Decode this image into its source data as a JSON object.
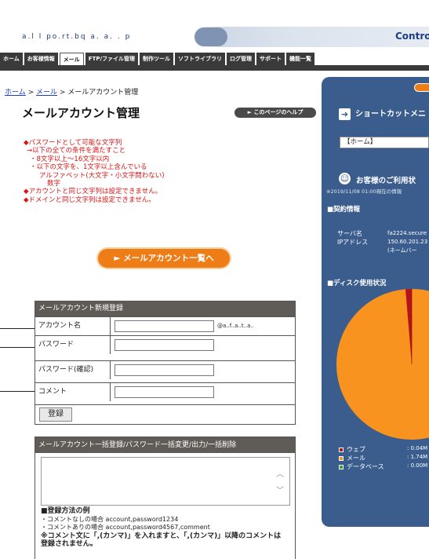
{
  "header": {
    "logo_text": "a.l l po.rt.bq a. a. . p",
    "control_label": "Contro"
  },
  "nav": {
    "items": [
      "ホーム",
      "お客様情報",
      "メール",
      "FTP/ファイル管理",
      "制作ツール",
      "ソフトライブラリ",
      "ログ管理",
      "サポート",
      "機能一覧"
    ],
    "active_index": 2
  },
  "breadcrumb": {
    "home": "ホーム",
    "sep1": " > ",
    "mail": "メール",
    "sep2": " > ",
    "current": "メールアカウント管理"
  },
  "page_title": "メールアカウント管理",
  "help_button": "► このページのヘルプ",
  "rules": [
    "◆パスワードとして可能な文字列",
    "→以下の全ての条件を満たすこと",
    "・8文字以上〜16文字以内",
    "・以下の文字を、1文字以上含んでいる",
    "アルファベット(大文字・小文字問わない)",
    "数字",
    "◆アカウントと同じ文字列は設定できません。",
    "◆ドメインと同じ文字列は設定できません。"
  ],
  "list_button": "► メールアカウント一覧へ",
  "form": {
    "title": "メールアカウント新規登録",
    "account_label": "アカウント名",
    "domain_suffix": "@a..f..a..t..a..",
    "password_label": "パスワード",
    "password_confirm_label": "パスワード(確認)",
    "comment_label": "コメント",
    "submit_label": "登録"
  },
  "bulk": {
    "title": "メールアカウント一括登録/パスワード一括変更/出力/一括削除",
    "example_heading": "■登録方法の例",
    "example_1": "・コメントなしの場合 account,password1234",
    "example_2": "・コメントありの場合 account,password4567,comment",
    "note_1": "※コメント文に「,(カンマ)」を入れますと、「,(カンマ)」以降のコメントは",
    "note_2": "登録されません。"
  },
  "right": {
    "shortcut_title": "ショートカットメニ",
    "shortcut_selected": "【ホーム】",
    "status_title": "お客様のご利用状",
    "status_date": "※2019/11/08 01:00現在の情報",
    "contract_heading": "■契約情報",
    "server_label": "サーバ名",
    "server_value": "fa2224.secure",
    "ip_label": "IPアドレス",
    "ip_value": "150.60.201.23",
    "ip_note": "(ネームバー",
    "disk_heading": "■ディスク使用状況",
    "legend": [
      {
        "label": "ウェブ",
        "value": ": 0.04M",
        "color": "#b5121b"
      },
      {
        "label": "メール",
        "value": ": 1.74M",
        "color": "#f7931e"
      },
      {
        "label": "データベース",
        "value": ": 0.00M",
        "color": "#2ea836"
      }
    ]
  },
  "colors": {
    "nav_bg": "#3a3a3a",
    "panel_bg": "#3b5d8e",
    "accent_orange": "#ee7d17",
    "rule_red": "#dd1111"
  }
}
